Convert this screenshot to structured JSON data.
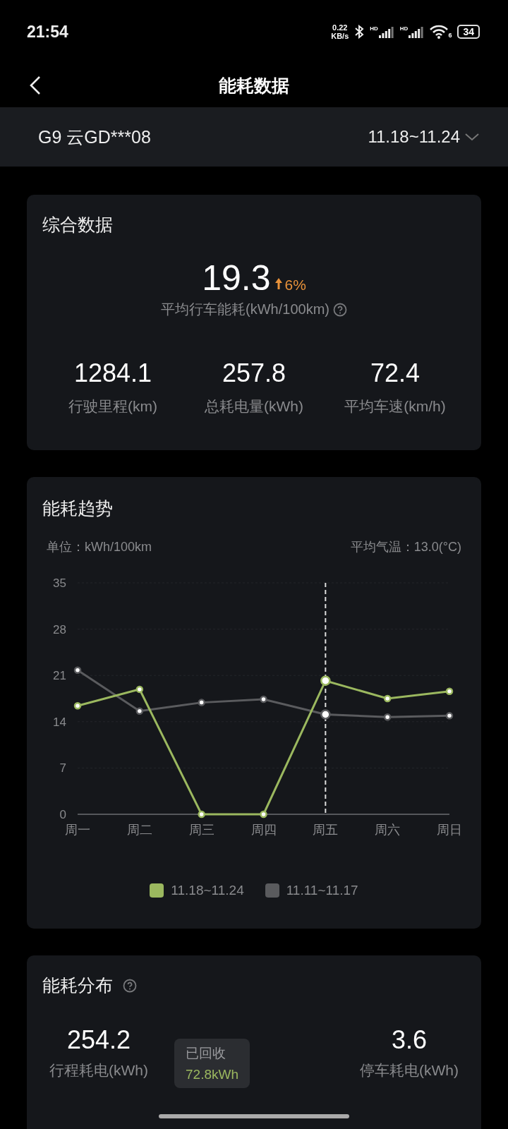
{
  "status_bar": {
    "time": "21:54",
    "net_speed": [
      "0.22",
      "KB/s"
    ],
    "signal_labels": [
      "HD",
      "HD"
    ],
    "wifi_label": "6",
    "battery": "34"
  },
  "header": {
    "title": "能耗数据"
  },
  "vehicle_bar": {
    "vehicle": "G9 云GD***08",
    "date_range": "11.18~11.24"
  },
  "summary": {
    "title": "综合数据",
    "main_value": "19.3",
    "change": "6%",
    "main_label": "平均行车能耗(kWh/100km)",
    "stats": [
      {
        "value": "1284.1",
        "label": "行驶里程(km)"
      },
      {
        "value": "257.8",
        "label": "总耗电量(kWh)"
      },
      {
        "value": "72.4",
        "label": "平均车速(km/h)"
      }
    ]
  },
  "trend": {
    "title": "能耗趋势",
    "unit": "单位：kWh/100km",
    "temperature": "平均气温：13.0(°C)",
    "chart_data": {
      "type": "line",
      "categories": [
        "周一",
        "周二",
        "周三",
        "周四",
        "周五",
        "周六",
        "周日"
      ],
      "series": [
        {
          "name": "11.18~11.24",
          "color": "#9bb85f",
          "values": [
            16.4,
            18.9,
            0,
            0,
            20.2,
            17.5,
            18.6
          ],
          "marker": true
        },
        {
          "name": "11.11~11.17",
          "color": "#5a5b5e",
          "values": [
            21.8,
            15.6,
            16.9,
            17.4,
            15.1,
            14.7,
            14.9
          ],
          "marker": true
        }
      ],
      "ylim": [
        0,
        35
      ],
      "yticks": [
        0,
        7,
        14,
        21,
        28,
        35
      ],
      "grid": true,
      "ref_lines": [
        {
          "axis": "x",
          "value": "周五"
        }
      ]
    }
  },
  "distribution": {
    "title": "能耗分布",
    "items": [
      {
        "value": "254.2",
        "label": "行程耗电(kWh)"
      },
      {
        "value": "3.6",
        "label": "停车耗电(kWh)"
      }
    ],
    "tooltip": {
      "label": "已回收",
      "value": "72.8kWh"
    }
  }
}
